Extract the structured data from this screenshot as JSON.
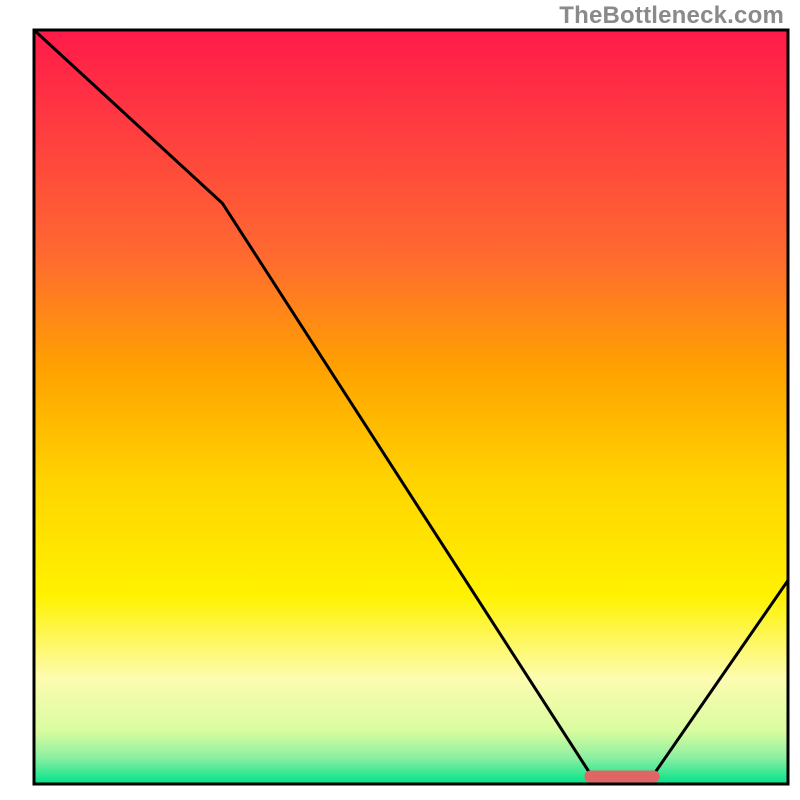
{
  "watermark": "TheBottleneck.com",
  "chart_data": {
    "type": "line",
    "title": "",
    "xlabel": "",
    "ylabel": "",
    "xlim": [
      0,
      100
    ],
    "ylim": [
      0,
      100
    ],
    "x": [
      0,
      25,
      74,
      82,
      100
    ],
    "values": [
      100,
      77,
      1,
      1,
      27
    ],
    "marker": {
      "x_start": 73,
      "x_end": 83,
      "y": 1
    },
    "gradient_stops": [
      {
        "offset": 0.0,
        "color": "#ff1a4a"
      },
      {
        "offset": 0.14,
        "color": "#ff3f3f"
      },
      {
        "offset": 0.3,
        "color": "#ff6a30"
      },
      {
        "offset": 0.45,
        "color": "#ffa200"
      },
      {
        "offset": 0.6,
        "color": "#ffd400"
      },
      {
        "offset": 0.75,
        "color": "#fff200"
      },
      {
        "offset": 0.86,
        "color": "#fdfcb0"
      },
      {
        "offset": 0.93,
        "color": "#d9fca0"
      },
      {
        "offset": 0.965,
        "color": "#8cf0a1"
      },
      {
        "offset": 1.0,
        "color": "#00e28a"
      }
    ],
    "border_color": "#000000",
    "line_color": "#000000",
    "marker_color": "#e06666"
  }
}
